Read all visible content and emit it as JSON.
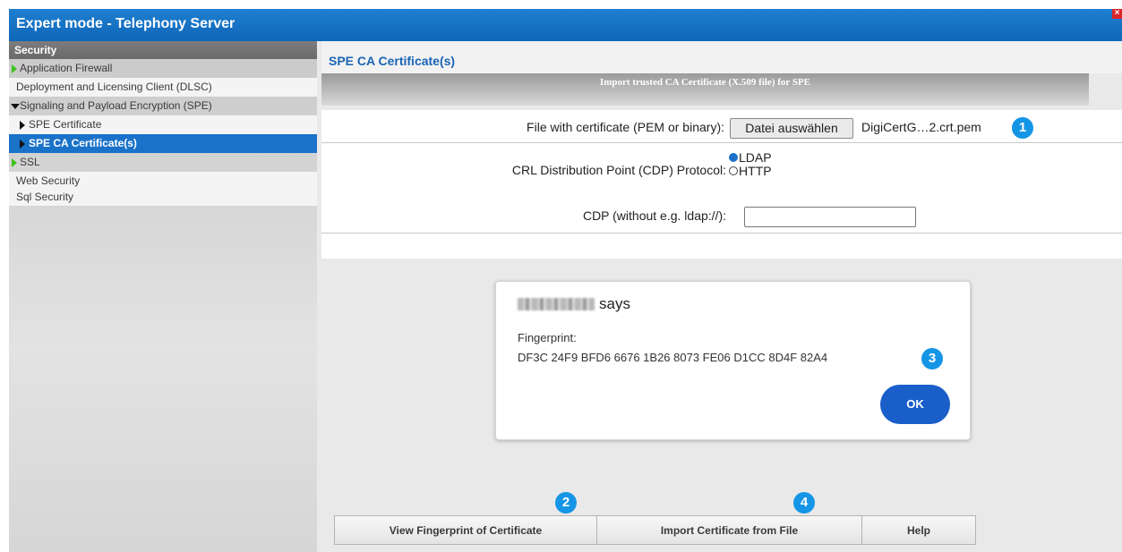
{
  "window": {
    "title": "Expert mode - Telephony Server",
    "close_symbol": "×"
  },
  "sidebar": {
    "section": "Security",
    "items": [
      {
        "label": "Application Firewall"
      },
      {
        "label": "Deployment and Licensing Client (DLSC)"
      },
      {
        "label": "Signaling and Payload Encryption (SPE)"
      },
      {
        "label": "SPE Certificate"
      },
      {
        "label": "SPE CA Certificate(s)"
      },
      {
        "label": "SSL"
      },
      {
        "label": "Web Security"
      },
      {
        "label": "Sql Security"
      }
    ]
  },
  "main": {
    "title": "SPE CA Certificate(s)",
    "import_bar": "Import trusted CA Certificate (X.509 file) for SPE",
    "form": {
      "file_label": "File with certificate (PEM or binary):",
      "file_button": "Datei auswählen",
      "file_name": "DigiCertG…2.crt.pem",
      "cdp_protocol_label": "CRL Distribution Point (CDP) Protocol:",
      "radio_options": [
        "LDAP",
        "HTTP"
      ],
      "radio_selected": "LDAP",
      "cdp_label": "CDP (without e.g. ldap://):",
      "cdp_value": ""
    },
    "dialog": {
      "says": "says",
      "fingerprint_label": "Fingerprint:",
      "fingerprint_value": "DF3C 24F9 BFD6 6676 1B26 8073 FE06 D1CC 8D4F 82A4",
      "ok_label": "OK"
    },
    "toolbar": {
      "view_fingerprint": "View Fingerprint of Certificate",
      "import_from_file": "Import Certificate from File",
      "help": "Help"
    }
  },
  "badges": [
    "1",
    "2",
    "3",
    "4"
  ],
  "colors": {
    "title_blue": "#0f66b8",
    "active_item": "#1a72c9",
    "badge": "#1595e6",
    "ok_button": "#1a5fc9"
  }
}
